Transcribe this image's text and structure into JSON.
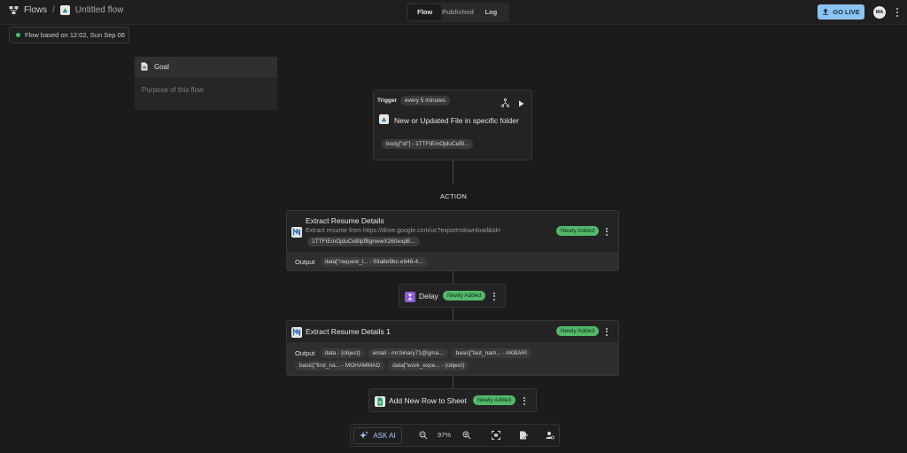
{
  "header": {
    "breadcrumb_root": "Flows",
    "breadcrumb_sep": "/",
    "flow_name": "Untitled flow",
    "tabs": [
      {
        "label": "Flow",
        "active": true
      },
      {
        "label": "Published",
        "active": false
      },
      {
        "label": "Log",
        "active": false
      }
    ],
    "go_live_label": "GO LIVE",
    "avatar_initials": "MA"
  },
  "status": {
    "text": "Flow based on 12:02, Sun Sep 06",
    "color": "#3ec46d"
  },
  "goal": {
    "title": "Goal",
    "placeholder": "Purpose of this flow"
  },
  "trigger": {
    "label": "Trigger",
    "schedule": "every 5 minutes",
    "title": "New or Updated File in specific folder",
    "param": "body[\"id\"] - 1TTFtEmOjduCeBl..."
  },
  "action_heading": "ACTION",
  "nodes": {
    "extract1": {
      "title": "Extract Resume Details",
      "subtitle": "Extract resume from https://drive.google.com/uc?export=download&id=",
      "id_chip": "1TTFtEmOjduCeBlpfBgnwwX260expB...",
      "badge": "Newly Added",
      "output_label": "Output",
      "outputs": [
        "data[\"request_i... - 93a8e9bc-e946-4..."
      ]
    },
    "delay": {
      "title": "Delay",
      "badge": "Newly Added"
    },
    "extract2": {
      "title": "Extract Resume Details 1",
      "badge": "Newly Added",
      "output_label": "Output",
      "outputs": [
        "data - {object}",
        "email - mr.binary71@gma...",
        "basic[\"last_nam... - AKBARI",
        "basic[\"first_na... - MOHAMMAD",
        "data[\"work_expe... - {object}"
      ]
    },
    "sheet": {
      "title": "Add New Row to Sheet",
      "badge": "Newly Added"
    }
  },
  "toolbar": {
    "ask_ai_label": "ASK AI",
    "zoom": "97%"
  },
  "colors": {
    "background": "#1b1b1b",
    "badge_green": "#54b86a",
    "go_live_blue": "#8bc4f2",
    "ai_accent": "#a9c4ff"
  }
}
